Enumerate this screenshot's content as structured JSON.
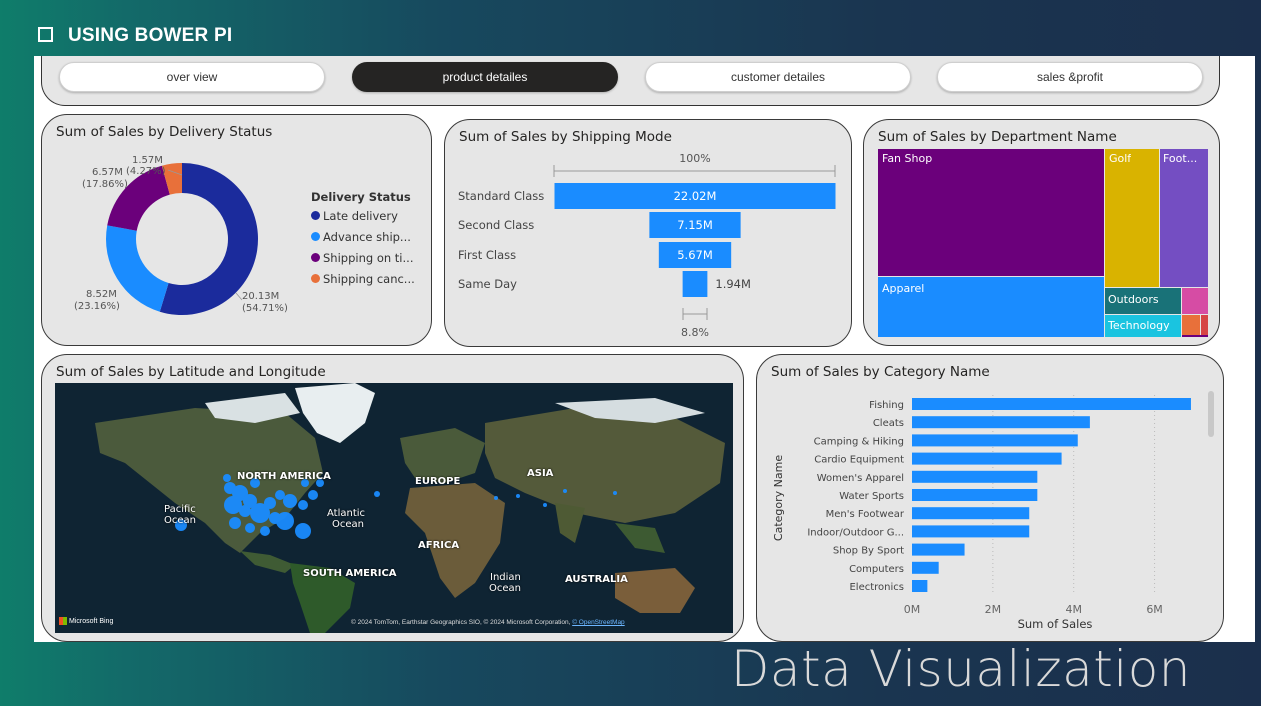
{
  "header": {
    "title": "USING BOWER PI"
  },
  "nav": {
    "buttons": [
      {
        "label": "over view",
        "active": false
      },
      {
        "label": "product detailes",
        "active": true
      },
      {
        "label": "customer detailes",
        "active": false
      },
      {
        "label": "sales &profit",
        "active": false
      }
    ]
  },
  "footer": {
    "title": "Data Visualization"
  },
  "colors": {
    "dark_blue": "#1b2b9c",
    "blue": "#1a8cff",
    "purple": "#6b007b",
    "orange": "#e8703a",
    "gold": "#d9b300",
    "violet": "#744ec2",
    "teal": "#197278",
    "cyan": "#1ac4e0",
    "pink": "#d64ca4"
  },
  "delivery": {
    "title": "Sum of Sales by Delivery Status",
    "legend_title": "Delivery Status",
    "legend": [
      "Late delivery",
      "Advance ship...",
      "Shipping on ti...",
      "Shipping canc..."
    ],
    "labels": {
      "late": [
        "20.13M",
        "(54.71%)"
      ],
      "advance": [
        "8.52M",
        "(23.16%)"
      ],
      "ontime": [
        "6.57M",
        "(17.86%)"
      ],
      "cancel": [
        "1.57M",
        "(4.27%)"
      ]
    }
  },
  "shipping": {
    "title": "Sum of Sales by Shipping Mode",
    "top_pct": "100%",
    "bottom_pct": "8.8%",
    "rows": [
      {
        "label": "Standard Class",
        "value_label": "22.02M"
      },
      {
        "label": "Second Class",
        "value_label": "7.15M"
      },
      {
        "label": "First Class",
        "value_label": "5.67M"
      },
      {
        "label": "Same Day",
        "value_label": "1.94M"
      }
    ]
  },
  "department": {
    "title": "Sum of Sales by Department Name",
    "tiles": [
      "Fan Shop",
      "Golf",
      "Foot...",
      "Apparel",
      "Outdoors",
      "Technology"
    ]
  },
  "map": {
    "title": "Sum of Sales by Latitude and Longitude",
    "labels": [
      "NORTH AMERICA",
      "EUROPE",
      "ASIA",
      "Pacific",
      "Ocean",
      "Atlantic",
      "Ocean",
      "AFRICA",
      "SOUTH AMERICA",
      "Indian",
      "Ocean",
      "AUSTRALIA"
    ],
    "bing": "Microsoft Bing",
    "attribution": "© 2024 TomTom, Earthstar Geographics SIO, © 2024 Microsoft Corporation,",
    "osm": "© OpenStreetMap"
  },
  "chart_data": [
    {
      "type": "pie",
      "title": "Sum of Sales by Delivery Status",
      "legend_title": "Delivery Status",
      "categories": [
        "Late delivery",
        "Advance ship...",
        "Shipping on ti...",
        "Shipping canc..."
      ],
      "values": [
        20.13,
        8.52,
        6.57,
        1.57
      ],
      "percent": [
        54.71,
        23.16,
        17.86,
        4.27
      ],
      "unit": "M"
    },
    {
      "type": "bar",
      "title": "Sum of Sales by Shipping Mode",
      "categories": [
        "Standard Class",
        "Second Class",
        "First Class",
        "Same Day"
      ],
      "values": [
        22.02,
        7.15,
        5.67,
        1.94
      ],
      "unit": "M"
    },
    {
      "type": "heatmap",
      "title": "Sum of Sales by Department Name",
      "categories": [
        "Fan Shop",
        "Apparel",
        "Golf",
        "Foot...",
        "Outdoors",
        "Technology"
      ]
    },
    {
      "type": "bar",
      "title": "Sum of Sales by Category Name",
      "categories": [
        "Fishing",
        "Cleats",
        "Camping & Hiking",
        "Cardio Equipment",
        "Women's Apparel",
        "Water Sports",
        "Men's Footwear",
        "Indoor/Outdoor G...",
        "Shop By Sport",
        "Computers",
        "Electronics"
      ],
      "values": [
        6.9,
        4.4,
        4.1,
        3.7,
        3.1,
        3.1,
        2.9,
        2.9,
        1.3,
        0.66,
        0.38
      ],
      "xlabel": "Sum of Sales",
      "ylabel": "Category Name",
      "xticks": [
        "0M",
        "2M",
        "4M",
        "6M"
      ],
      "xlim": [
        0,
        7
      ],
      "unit": "M"
    }
  ]
}
